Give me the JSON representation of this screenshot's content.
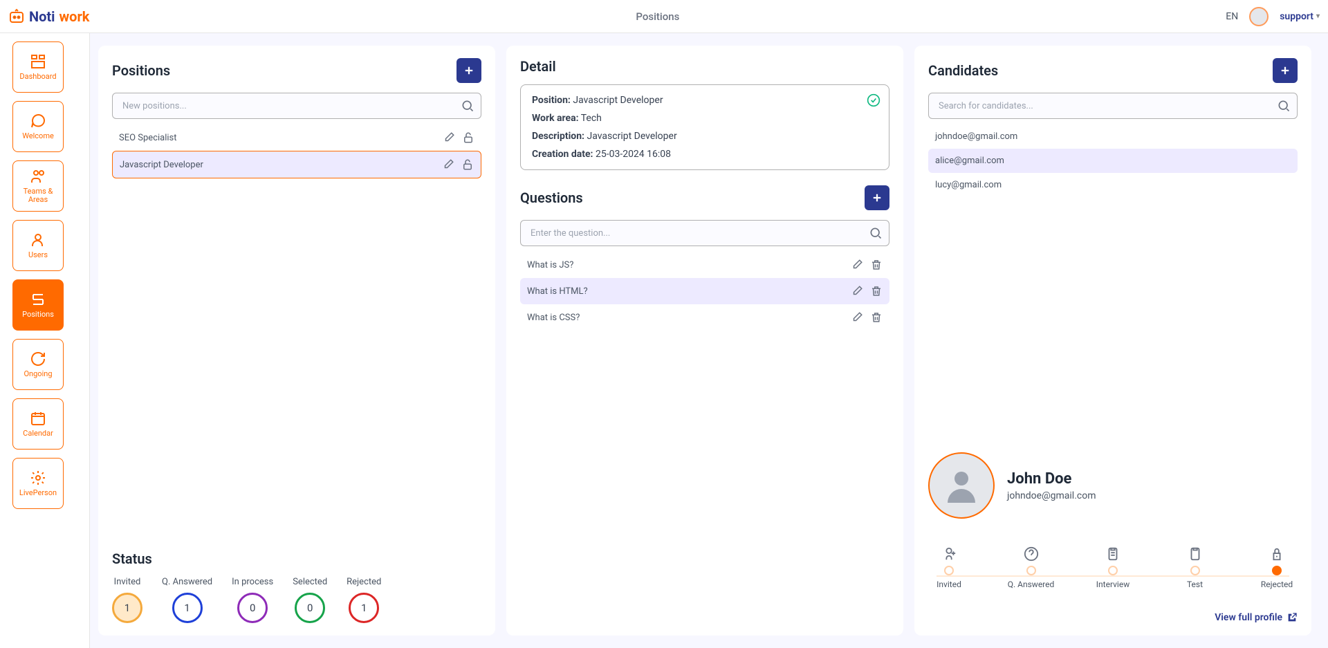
{
  "header": {
    "title": "Positions",
    "lang": "EN",
    "user": "support",
    "logo1": "Noti",
    "logo2": "work"
  },
  "sidebar": {
    "items": [
      {
        "label": "Dashboard"
      },
      {
        "label": "Welcome"
      },
      {
        "label": "Teams & Areas"
      },
      {
        "label": "Users"
      },
      {
        "label": "Positions"
      },
      {
        "label": "Ongoing"
      },
      {
        "label": "Calendar"
      },
      {
        "label": "LivePerson"
      }
    ]
  },
  "positions": {
    "title": "Positions",
    "search_placeholder": "New positions...",
    "items": [
      {
        "label": "SEO Specialist"
      },
      {
        "label": "Javascript Developer"
      }
    ]
  },
  "status": {
    "title": "Status",
    "items": [
      {
        "label": "Invited",
        "value": "1",
        "color": "#f4a93c",
        "bg": "#ffe9c9"
      },
      {
        "label": "Q. Answered",
        "value": "1",
        "color": "#1e40d8",
        "bg": "#fff"
      },
      {
        "label": "In process",
        "value": "0",
        "color": "#8e2bb8",
        "bg": "#fff"
      },
      {
        "label": "Selected",
        "value": "0",
        "color": "#16a34a",
        "bg": "#fff"
      },
      {
        "label": "Rejected",
        "value": "1",
        "color": "#dc2626",
        "bg": "#fff"
      }
    ]
  },
  "detail": {
    "title": "Detail",
    "pos_lab": "Position:",
    "pos_val": "Javascript Developer",
    "area_lab": "Work area:",
    "area_val": "Tech",
    "desc_lab": "Description:",
    "desc_val": "Javascript Developer",
    "date_lab": "Creation date:",
    "date_val": "25-03-2024 16:08"
  },
  "questions": {
    "title": "Questions",
    "search_placeholder": "Enter the question...",
    "items": [
      {
        "label": "What is JS?"
      },
      {
        "label": "What is HTML?"
      },
      {
        "label": "What is CSS?"
      }
    ]
  },
  "candidates": {
    "title": "Candidates",
    "search_placeholder": "Search for candidates...",
    "items": [
      {
        "label": "johndoe@gmail.com"
      },
      {
        "label": "alice@gmail.com"
      },
      {
        "label": "lucy@gmail.com"
      }
    ]
  },
  "profile": {
    "name": "John Doe",
    "email": "johndoe@gmail.com",
    "view_label": "View full profile",
    "stages": [
      {
        "label": "Invited"
      },
      {
        "label": "Q. Answered"
      },
      {
        "label": "Interview"
      },
      {
        "label": "Test"
      },
      {
        "label": "Rejected"
      }
    ]
  }
}
